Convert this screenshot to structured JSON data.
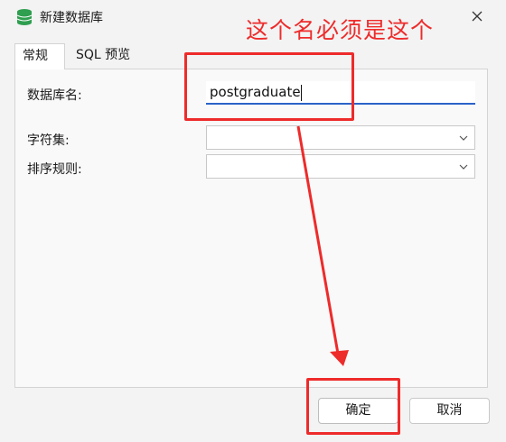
{
  "window": {
    "title": "新建数据库",
    "icon": "database-icon",
    "close_icon": "close-icon"
  },
  "tabs": [
    {
      "label": "常规",
      "active": true
    },
    {
      "label": "SQL 预览",
      "active": false
    }
  ],
  "form": {
    "db_name_label": "数据库名:",
    "db_name_value": "postgraduate",
    "charset_label": "字符集:",
    "charset_value": "",
    "collation_label": "排序规则:",
    "collation_value": ""
  },
  "buttons": {
    "ok": "确定",
    "cancel": "取消"
  },
  "annotation": {
    "text": "这个名必须是这个",
    "color": "#ee2b2b"
  },
  "colors": {
    "input_focus": "#2a62c9"
  }
}
